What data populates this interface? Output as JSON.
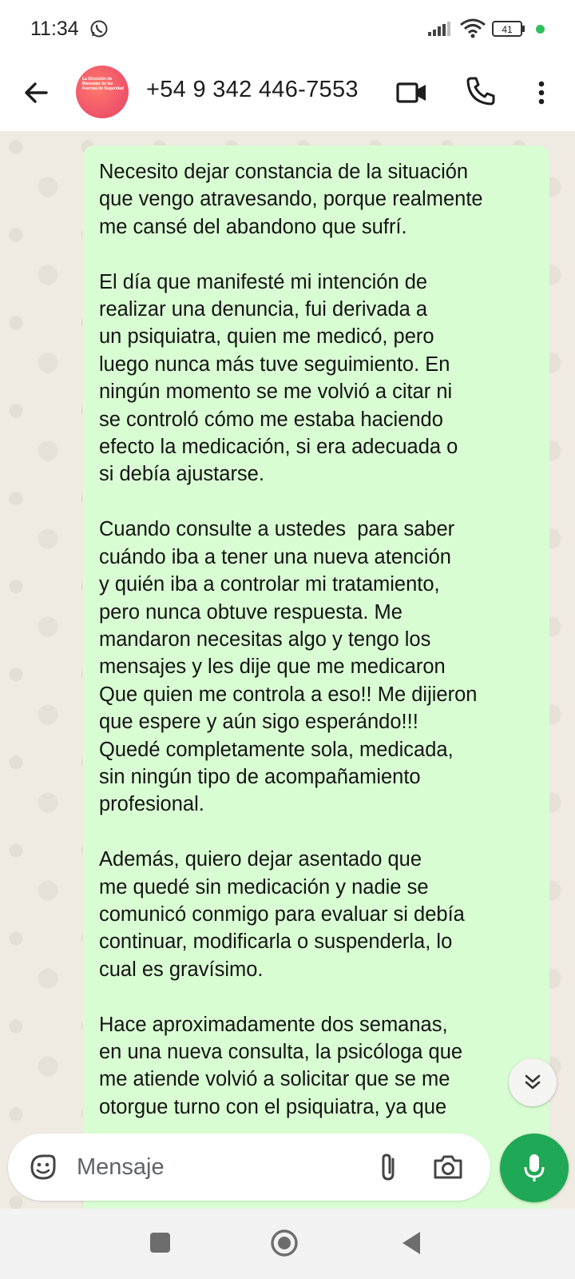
{
  "status_bar": {
    "time": "11:34",
    "battery": "41",
    "icons": [
      "whatsapp-icon",
      "signal-icon",
      "wifi-icon",
      "battery-icon",
      "notification-dot"
    ]
  },
  "header": {
    "contact": "+54 9 342 446-7553",
    "avatar_caption": "La Dirección de Bienestar de las Fuerzas de Seguridad",
    "icons": [
      "back-arrow-icon",
      "video-call-icon",
      "phone-icon",
      "more-vert-icon"
    ]
  },
  "message": {
    "text": "Necesito dejar constancia de la situación\nque vengo atravesando, porque realmente\nme cansé del abandono que sufrí.\n\nEl día que manifesté mi intención de\nrealizar una denuncia, fui derivada a\nun psiquiatra, quien me medicó, pero\nluego nunca más tuve seguimiento. En\nningún momento se me volvió a citar ni\nse controló cómo me estaba haciendo\nefecto la medicación, si era adecuada o\nsi debía ajustarse.\n\nCuando consulte a ustedes  para saber\ncuándo iba a tener una nueva atención\ny quién iba a controlar mi tratamiento,\npero nunca obtuve respuesta. Me\nmandaron necesitas algo y tengo los\nmensajes y les dije que me medicaron\nQue quien me controla a eso!! Me dijieron\nque espere y aún sigo esperándo!!!\nQuedé completamente sola, medicada,\nsin ningún tipo de acompañamiento\nprofesional.\n\nAdemás, quiero dejar asentado que\nme quedé sin medicación y nadie se\ncomunicó conmigo para evaluar si debía\ncontinuar, modificarla o suspenderla, lo\ncual es gravísimo.\n\nHace aproximadamente dos semanas,\nen una nueva consulta, la psicóloga que\nme atiende volvió a solicitar que se me\notorgue turno con el psiquiatra, ya que",
    "bubble_color": "#d9fdd3"
  },
  "composer": {
    "placeholder": "Mensaje",
    "icons": [
      "sticker-icon",
      "attach-icon",
      "camera-icon",
      "mic-icon"
    ],
    "mic_color": "#1fa855"
  },
  "colors": {
    "chat_background": "#efeae2",
    "accent": "#1fa855"
  }
}
